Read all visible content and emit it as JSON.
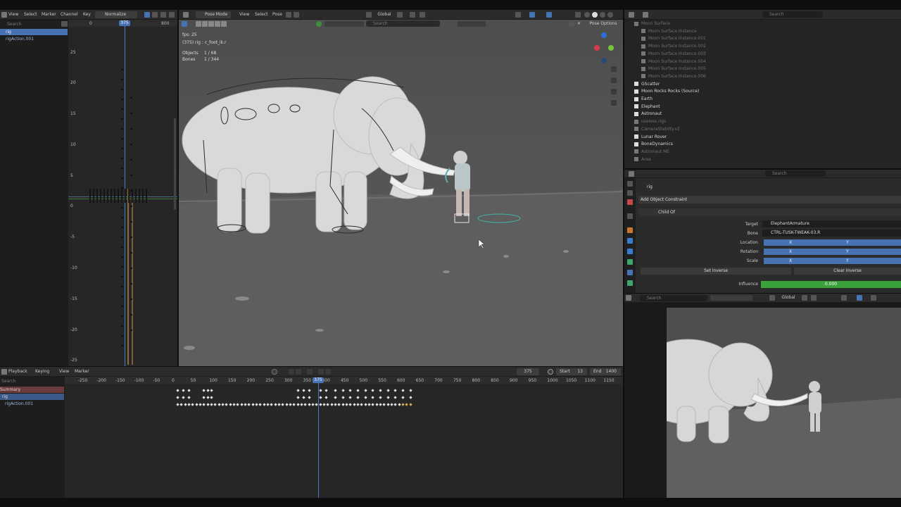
{
  "graph_editor": {
    "menu": [
      "View",
      "Select",
      "Marker",
      "Channel",
      "Key"
    ],
    "normalize": "Normalize",
    "search_placeholder": "Search",
    "channels": [
      {
        "label": "rig",
        "selected": true
      },
      {
        "label": "rigAction.001",
        "selected": false
      }
    ],
    "frame_ruler": [
      "0",
      "375",
      "800"
    ],
    "current_frame": "375",
    "y_ticks": [
      "25",
      "20",
      "15",
      "10",
      "5",
      "0",
      "-5",
      "-10",
      "-15",
      "-20",
      "-25"
    ]
  },
  "viewport": {
    "mode": "Pose Mode",
    "menu": [
      "View",
      "Select",
      "Pose"
    ],
    "orientation": "Global",
    "search_placeholder": "Search",
    "pose_options": "Pose Options",
    "fps": "fps: 25",
    "bone_info": "(375) rig : c_foot_ik.r",
    "objects_label": "Objects",
    "objects_value": "1 / 68",
    "bones_label": "Bones",
    "bones_value": "1 / 344"
  },
  "outliner": {
    "search_placeholder": "Search",
    "items": [
      {
        "label": "Moon Surface",
        "indent": 0,
        "dim": true
      },
      {
        "label": "Moon Surface Instance",
        "indent": 1,
        "dim": true
      },
      {
        "label": "Moon Surface Instance.001",
        "indent": 1,
        "dim": true
      },
      {
        "label": "Moon Surface Instance.002",
        "indent": 1,
        "dim": true
      },
      {
        "label": "Moon Surface Instance.003",
        "indent": 1,
        "dim": true
      },
      {
        "label": "Moon Surface Instance.004",
        "indent": 1,
        "dim": true
      },
      {
        "label": "Moon Surface Instance.005",
        "indent": 1,
        "dim": true
      },
      {
        "label": "Moon Surface Instance.006",
        "indent": 1,
        "dim": true
      },
      {
        "label": "GScatter",
        "indent": 0,
        "dim": false
      },
      {
        "label": "Moon Rocks Rocks (Source)",
        "indent": 0,
        "dim": false
      },
      {
        "label": "Earth",
        "indent": 0,
        "dim": false
      },
      {
        "label": "Elephant",
        "indent": 0,
        "dim": false
      },
      {
        "label": "Astronaut",
        "indent": 0,
        "dim": false
      },
      {
        "label": "useless rigs",
        "indent": 0,
        "dim": true
      },
      {
        "label": "CameraStabilty.v2",
        "indent": 0,
        "dim": true
      },
      {
        "label": "Lunar Rover",
        "indent": 0,
        "dim": false
      },
      {
        "label": "BoneDynamics",
        "indent": 0,
        "dim": false
      },
      {
        "label": "Astronaut ME",
        "indent": 0,
        "dim": true
      },
      {
        "label": "Area",
        "indent": 0,
        "dim": true
      }
    ]
  },
  "properties": {
    "search_placeholder": "Search",
    "object_name": "rig",
    "add_constraint": "Add Object Constraint",
    "constraint_name": "Child Of",
    "target_label": "Target",
    "target_value": "ElephantArmature",
    "bone_label": "Bone",
    "bone_value": "CTRL-TUSK-TWEAK-03.R",
    "location_label": "Location",
    "rotation_label": "Rotation",
    "scale_label": "Scale",
    "axes": [
      "X",
      "Y"
    ],
    "set_inverse": "Set Inverse",
    "clear_inverse": "Clear Inverse",
    "influence_label": "Influence",
    "influence_value": "0.000",
    "influence_fraction": 1.0
  },
  "preview": {
    "orientation": "Global",
    "search_placeholder": "Search"
  },
  "dopesheet": {
    "menu": [
      "Playback",
      "Keying",
      "View",
      "Marker"
    ],
    "search_placeholder": "Search",
    "channels": [
      {
        "label": "Summary",
        "kind": "summary"
      },
      {
        "label": "rig",
        "kind": "object"
      },
      {
        "label": "rigAction.001",
        "kind": "action"
      }
    ],
    "current_frame": "375",
    "start_label": "Start",
    "start_value": "13",
    "end_label": "End",
    "end_value": "1400",
    "ruler": [
      "-250",
      "-200",
      "-150",
      "-100",
      "-50",
      "0",
      "50",
      "100",
      "150",
      "200",
      "250",
      "300",
      "350",
      "400",
      "450",
      "500",
      "550",
      "600",
      "650",
      "700",
      "750",
      "800",
      "850",
      "900",
      "950",
      "1000",
      "1050",
      "1100",
      "1150"
    ],
    "playhead_label": "375"
  }
}
